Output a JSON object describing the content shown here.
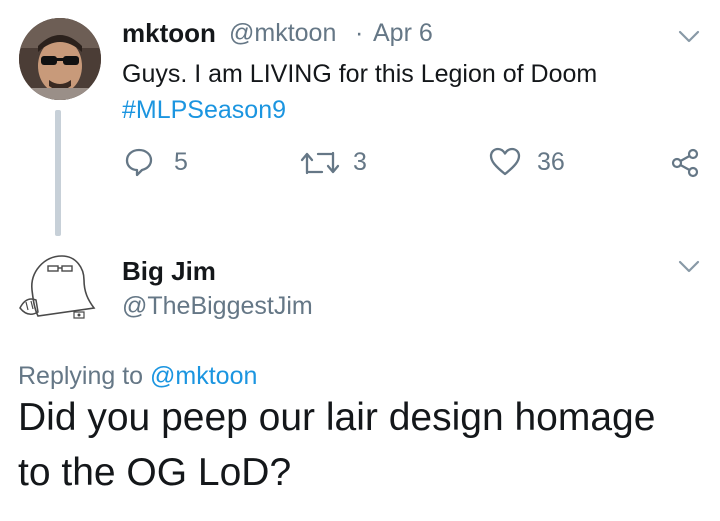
{
  "tweet": {
    "author_name": "mktoon",
    "handle": "@mktoon",
    "separator": "·",
    "date": "Apr 6",
    "text": "Guys. I am LIVING for this Legion of Doom",
    "hashtag": "#MLPSeason9",
    "replies": "5",
    "retweets": "3",
    "likes": "36",
    "icons": {
      "reply": "reply-icon",
      "retweet": "retweet-icon",
      "like": "heart-icon",
      "share": "share-icon",
      "menu": "chevron-down-icon"
    }
  },
  "reply": {
    "author_name": "Big Jim",
    "handle": "@TheBiggestJim",
    "replying_prefix": "Replying to",
    "replying_to": "@mktoon",
    "text_line1": "Did you peep our lair design homage",
    "text_line2": "to the OG LoD?"
  },
  "colors": {
    "link": "#1b95e0",
    "muted": "#657786",
    "text": "#14171a",
    "thread_line": "#c7d0d8"
  }
}
